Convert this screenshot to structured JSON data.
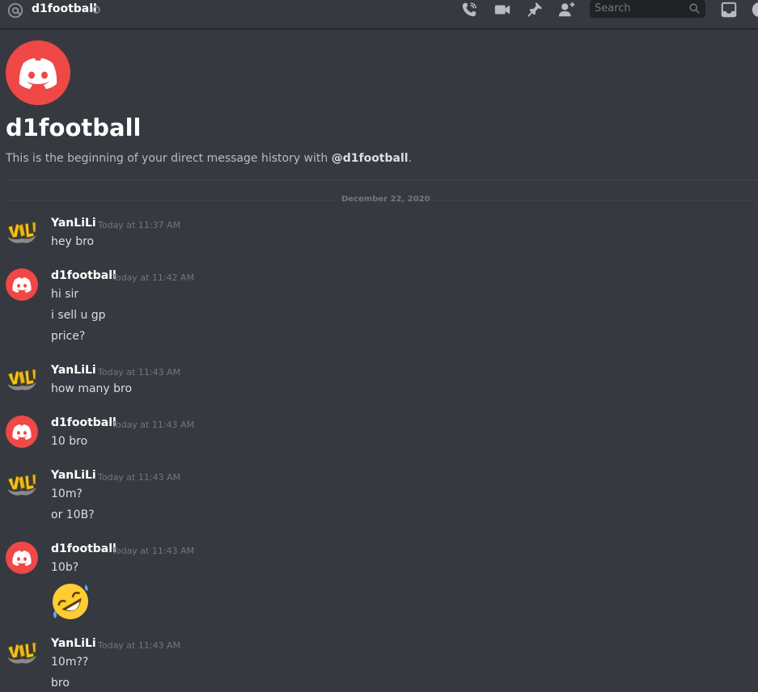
{
  "topbar": {
    "channel": "d1football",
    "search_placeholder": "Search"
  },
  "header": {
    "title": "d1football",
    "subtitle_prefix": "This is the beginning of your direct message history with ",
    "subtitle_user": "@d1football",
    "subtitle_suffix": "."
  },
  "date_divider": "December 22, 2020",
  "messages": [
    {
      "author": "YanLiLi",
      "time": "Today at 11:37 AM",
      "lines": [
        "hey bro"
      ]
    },
    {
      "author": "d1football",
      "time": "Today at 11:42 AM",
      "lines": [
        "hi sir",
        "i sell u gp",
        "price?"
      ]
    },
    {
      "author": "YanLiLi",
      "time": "Today at 11:43 AM",
      "lines": [
        "how many bro"
      ]
    },
    {
      "author": "d1football",
      "time": "Today at 11:43 AM",
      "lines": [
        "10 bro"
      ]
    },
    {
      "author": "YanLiLi",
      "time": "Today at 11:43 AM",
      "lines": [
        "10m?",
        "or 10B?"
      ]
    },
    {
      "author": "d1football",
      "time": "Today at 11:43 AM",
      "lines": [
        "10b?"
      ],
      "emoji": "rofl-emoji"
    },
    {
      "author": "YanLiLi",
      "time": "Today at 11:43 AM",
      "lines": [
        "10m??",
        "bro"
      ]
    }
  ],
  "colors": {
    "accent": "#f04747",
    "background": "#36393f",
    "search_bg": "#202225"
  },
  "icons": [
    "at-icon",
    "phone-icon",
    "video-icon",
    "pin-icon",
    "add-friend-icon",
    "search-icon",
    "inbox-icon",
    "help-icon"
  ]
}
